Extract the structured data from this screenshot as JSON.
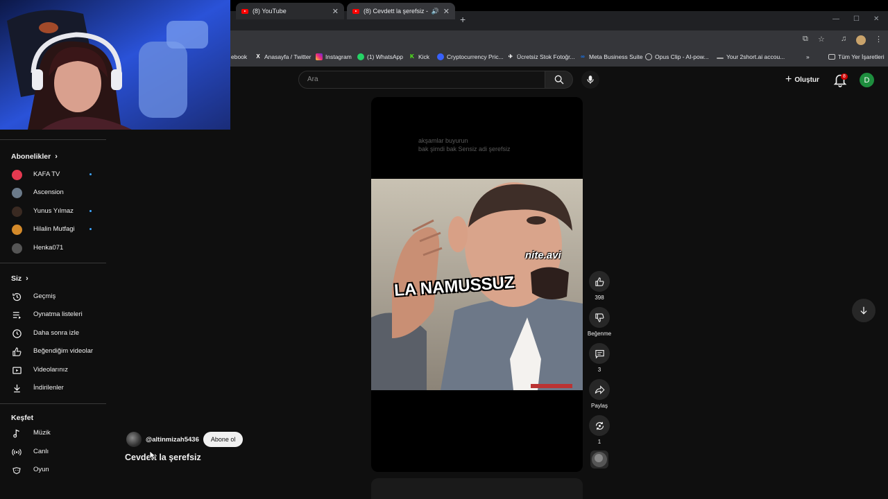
{
  "browser": {
    "tabs": [
      {
        "title": "(8) YouTube",
        "active": false
      },
      {
        "title": "(8) Cevdett la şerefsiz - You",
        "active": true
      }
    ],
    "bookmarks": [
      {
        "label": "ebook",
        "icon": "facebook-icon"
      },
      {
        "label": "Anasayfa / Twitter",
        "icon": "x-icon"
      },
      {
        "label": "Instagram",
        "icon": "instagram-icon"
      },
      {
        "label": "(1) WhatsApp",
        "icon": "whatsapp-icon"
      },
      {
        "label": "Kick",
        "icon": "kick-icon"
      },
      {
        "label": "Cryptocurrency Pric...",
        "icon": "coin-icon"
      },
      {
        "label": "Ücretsiz Stok Fotoğr...",
        "icon": "photo-icon"
      },
      {
        "label": "Meta Business Suite",
        "icon": "meta-icon"
      },
      {
        "label": "Opus Clip - AI-pow...",
        "icon": "opus-icon"
      },
      {
        "label": "Your 2short.ai accou...",
        "icon": "line-icon"
      }
    ],
    "all_bookmarks": "Tüm Yer İşaretleri"
  },
  "header": {
    "search_placeholder": "Ara",
    "create_label": "Oluştur",
    "notif_count": "8",
    "avatar_letter": "D"
  },
  "sidebar": {
    "subs_heading": "Abonelikler",
    "subscriptions": [
      {
        "name": "KAFA TV",
        "new": true,
        "color": "#e53950"
      },
      {
        "name": "Ascension",
        "new": false,
        "color": "#6b7a8a"
      },
      {
        "name": "Yunus Yılmaz",
        "new": true,
        "color": "#3a2a22"
      },
      {
        "name": "Hilalin Mutfagi",
        "new": true,
        "color": "#d48a2a"
      },
      {
        "name": "Henka071",
        "new": false,
        "color": "#555555"
      }
    ],
    "you_heading": "Siz",
    "you_items": [
      {
        "label": "Geçmiş",
        "icon": "history-icon"
      },
      {
        "label": "Oynatma listeleri",
        "icon": "playlists-icon"
      },
      {
        "label": "Daha sonra izle",
        "icon": "watch-later-icon"
      },
      {
        "label": "Beğendiğim videolar",
        "icon": "liked-icon"
      },
      {
        "label": "Videolarınız",
        "icon": "your-videos-icon"
      },
      {
        "label": "İndirilenler",
        "icon": "downloads-icon"
      }
    ],
    "explore_heading": "Keşfet",
    "explore_items": [
      {
        "label": "Müzik",
        "icon": "music-icon"
      },
      {
        "label": "Canlı",
        "icon": "live-icon"
      },
      {
        "label": "Oyun",
        "icon": "gaming-icon"
      }
    ]
  },
  "short": {
    "caption_line1": "akşamlar buyurun",
    "caption_line2": "bak şimdi bak Sensiz adi şerefsiz",
    "overlay_watermark": "nite.avi",
    "overlay_text": "LA NAMUSSUZ",
    "likes": "398",
    "dislike_label": "Beğenme",
    "comments": "3",
    "share_label": "Paylaş",
    "remix_count": "1",
    "channel_handle": "@altinmizah5436",
    "subscribe_label": "Abone ol",
    "title": "Cevdett la şerefsiz"
  }
}
